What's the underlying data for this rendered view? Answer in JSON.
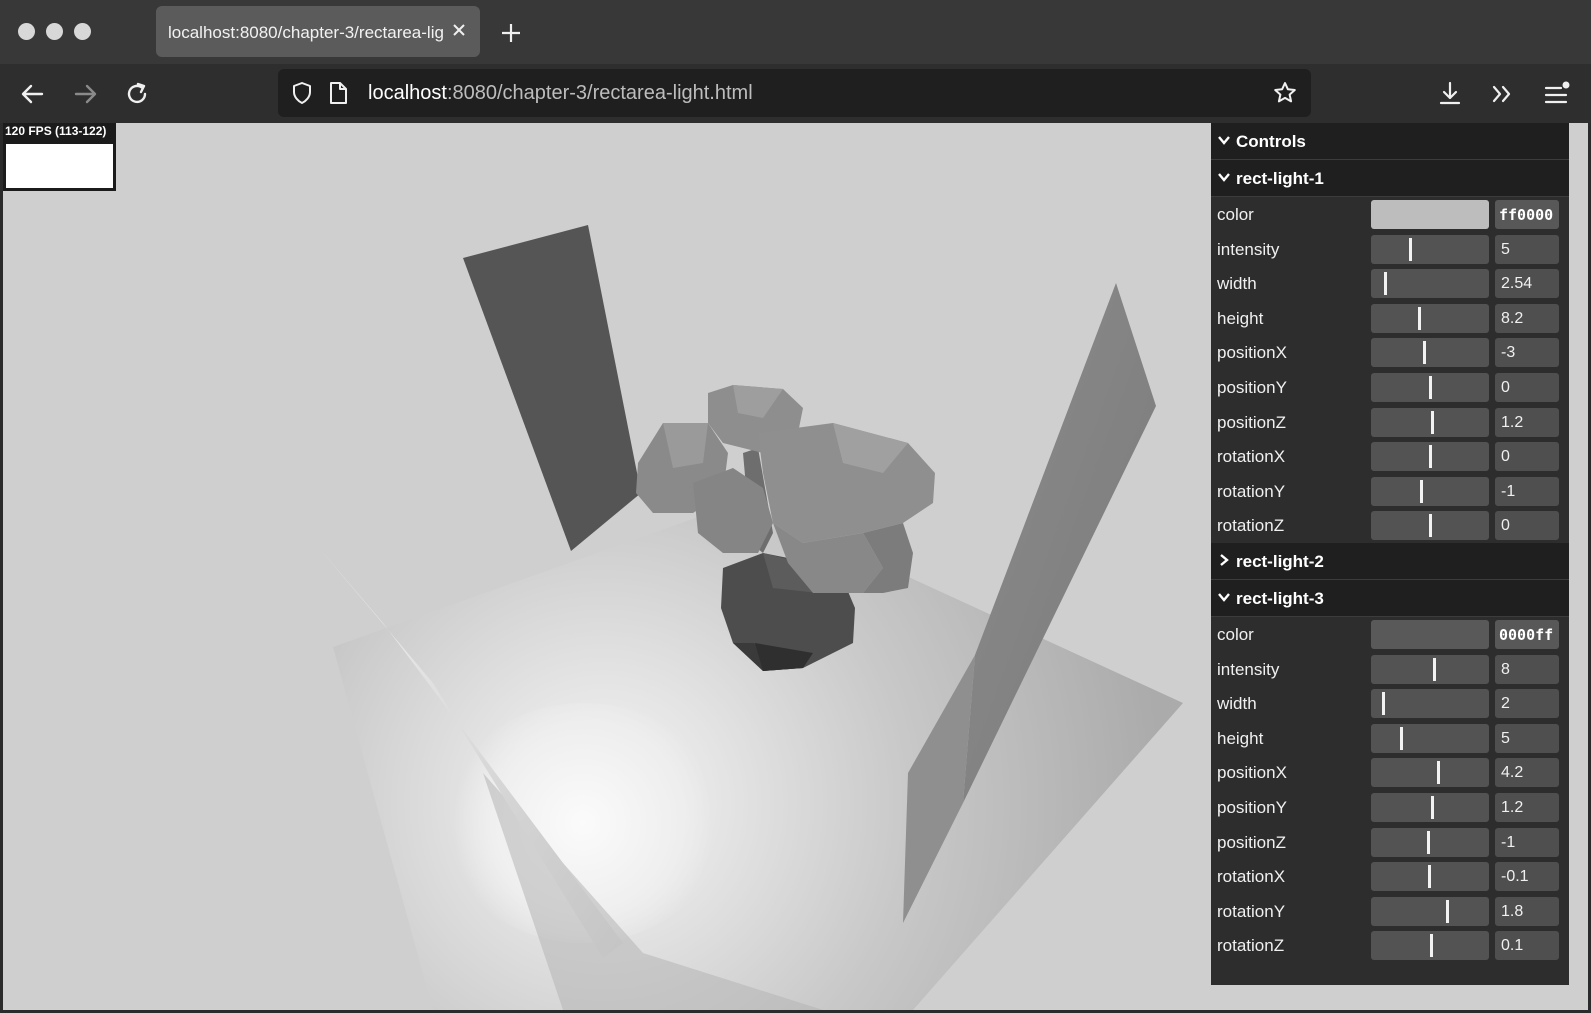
{
  "browser": {
    "tab_title": "localhost:8080/chapter-3/rectarea-light.html",
    "url_host": "localhost",
    "url_path": ":8080/chapter-3/rectarea-light.html"
  },
  "stats": {
    "label": "120 FPS (113-122)"
  },
  "controls": {
    "title": "Controls",
    "folders": [
      {
        "name": "rect-light-1",
        "expanded": true,
        "color": {
          "label": "color",
          "value": "ff0000",
          "swatch": "#bdbdbd"
        },
        "params": [
          {
            "label": "intensity",
            "value": "5",
            "fraction": 0.33
          },
          {
            "label": "width",
            "value": "2.54",
            "fraction": 0.12
          },
          {
            "label": "height",
            "value": "8.2",
            "fraction": 0.41
          },
          {
            "label": "positionX",
            "value": "-3",
            "fraction": 0.45
          },
          {
            "label": "positionY",
            "value": "0",
            "fraction": 0.5
          },
          {
            "label": "positionZ",
            "value": "1.2",
            "fraction": 0.52
          },
          {
            "label": "rotationX",
            "value": "0",
            "fraction": 0.5
          },
          {
            "label": "rotationY",
            "value": "-1",
            "fraction": 0.42
          },
          {
            "label": "rotationZ",
            "value": "0",
            "fraction": 0.5
          }
        ]
      },
      {
        "name": "rect-light-2",
        "expanded": false
      },
      {
        "name": "rect-light-3",
        "expanded": true,
        "color": {
          "label": "color",
          "value": "0000ff",
          "swatch": "#595959"
        },
        "params": [
          {
            "label": "intensity",
            "value": "8",
            "fraction": 0.53
          },
          {
            "label": "width",
            "value": "2",
            "fraction": 0.1
          },
          {
            "label": "height",
            "value": "5",
            "fraction": 0.25
          },
          {
            "label": "positionX",
            "value": "4.2",
            "fraction": 0.57
          },
          {
            "label": "positionY",
            "value": "1.2",
            "fraction": 0.52
          },
          {
            "label": "positionZ",
            "value": "-1",
            "fraction": 0.48
          },
          {
            "label": "rotationX",
            "value": "-0.1",
            "fraction": 0.49
          },
          {
            "label": "rotationY",
            "value": "1.8",
            "fraction": 0.64
          },
          {
            "label": "rotationZ",
            "value": "0.1",
            "fraction": 0.51
          }
        ]
      }
    ]
  }
}
